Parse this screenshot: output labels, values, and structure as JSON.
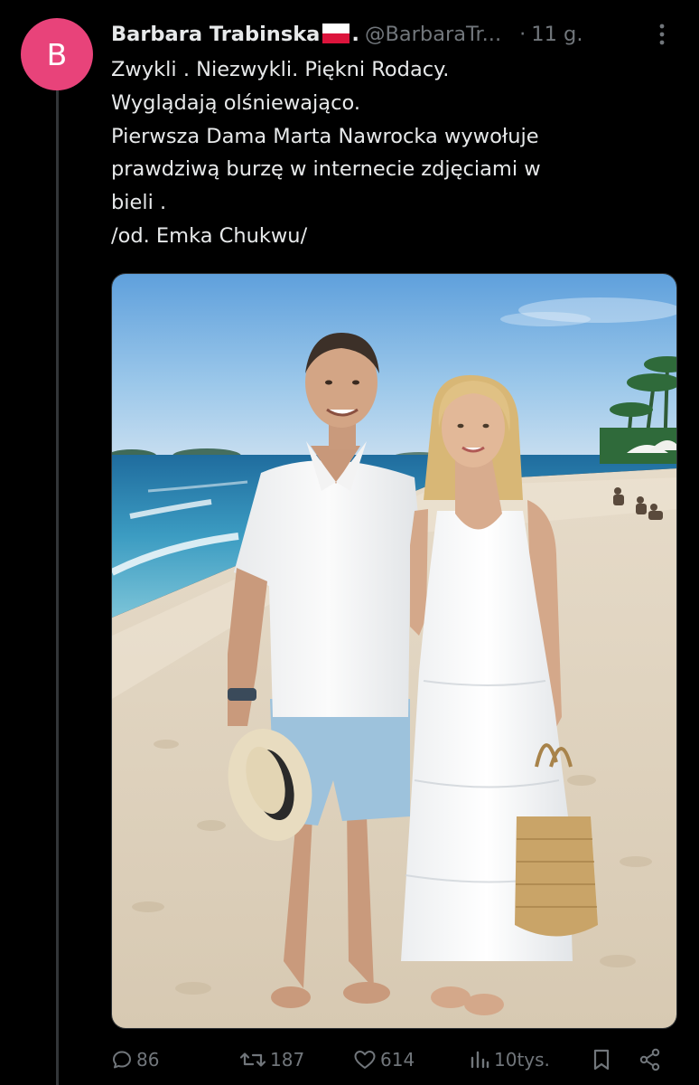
{
  "tweet": {
    "avatar_letter": "B",
    "display_name": "Barbara Trabinska",
    "name_suffix": ".",
    "handle": "@BarbaraTr...",
    "separator": "·",
    "time": "11 g.",
    "text_lines": [
      "Zwykli . Niezwykli. Piękni Rodacy.",
      "Wyglądają olśniewająco.",
      "Pierwsza Dama  Marta Nawrocka wywołuje",
      "prawdziwą burzę w internecie  zdjęciami w",
      "bieli .",
      "/od. Emka Chukwu/"
    ]
  },
  "actions": {
    "replies": "86",
    "retweets": "187",
    "likes": "614",
    "views": "10tys."
  },
  "colors": {
    "background": "#000000",
    "text": "#e7e9ea",
    "secondary": "#71767b",
    "avatar": "#e8437a",
    "thread_line": "#333639"
  },
  "icons": {
    "flag": "poland-flag-icon",
    "more": "more-vertical-icon",
    "reply": "reply-icon",
    "retweet": "retweet-icon",
    "like": "heart-icon",
    "views": "views-icon",
    "bookmark": "bookmark-icon",
    "share": "share-icon"
  }
}
